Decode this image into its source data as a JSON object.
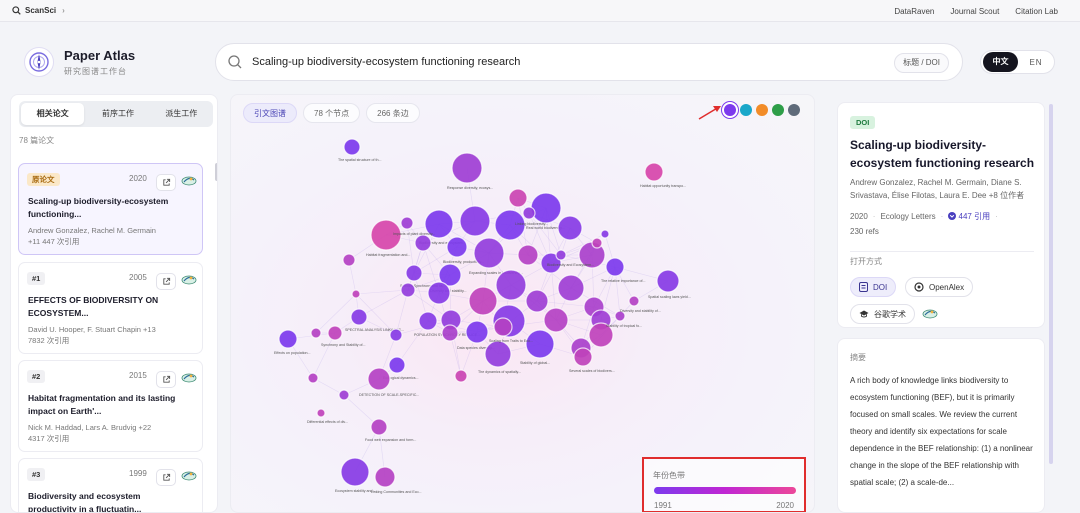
{
  "topbar": {
    "brand": "ScanSci",
    "links": [
      "DataRaven",
      "Journal Scout",
      "Citation Lab"
    ]
  },
  "header": {
    "app_title": "Paper Atlas",
    "app_subtitle": "研究图谱工作台",
    "search_value": "Scaling‐up biodiversity‐ecosystem functioning research",
    "search_tag": "标题 / DOI",
    "lang_active": "中文",
    "lang_other": "EN"
  },
  "left": {
    "tabs": [
      "相关论文",
      "前序工作",
      "派生工作"
    ],
    "count": "78 篇论文",
    "papers": [
      {
        "badge": "原论文",
        "year": "2020",
        "title": "Scaling‐up biodiversity‐ecosystem functioning...",
        "authors": "Andrew Gonzalez, Rachel M. Germain +11",
        "cites": "447 次引用"
      },
      {
        "badge": "#1",
        "year": "2005",
        "title": "EFFECTS OF BIODIVERSITY ON ECOSYSTEM...",
        "authors": "David U. Hooper, F. Stuart Chapin +13",
        "cites": "7832 次引用"
      },
      {
        "badge": "#2",
        "year": "2015",
        "title": "Habitat fragmentation and its lasting impact on Earth'...",
        "authors": "Nick M. Haddad, Lars A. Brudvig +22",
        "cites": "4317 次引用"
      },
      {
        "badge": "#3",
        "year": "1999",
        "title": "Biodiversity and ecosystem productivity in a fluctuatin...",
        "authors": "",
        "cites": ""
      }
    ]
  },
  "graph": {
    "tabs": [
      "引文图谱",
      "78 个节点",
      "266 条边"
    ],
    "swatches": [
      "#7c3aed",
      "#1aa7c9",
      "#f28c28",
      "#2e9e48",
      "#5f6b7a"
    ],
    "legend_title": "年份色带",
    "legend_start": "1991",
    "legend_end": "2020",
    "node_labels": [
      "The spatial structure of th...",
      "Response diversity, ecosys...",
      "Habitat opportunity transpo...",
      "Real world biodiversity...",
      "Biodiversity and ecosystem...",
      "Habitat fragmentation and...",
      "Biodiversity, productivity...",
      "Expanding scales in biodiversity...",
      "Species Synchrony and Its...",
      "Diversity and stability...",
      "The relative importance of...",
      "Spatial scaling laws yield...",
      "SPECTRAL ANALYSIS LINKAGES...",
      "POPULATION SYNCHRONY REDUCE...",
      "Effects on population...",
      "Synchrony and Stability of...",
      "Biodiversity and Ecosystem...",
      "Diversity and stability of...",
      "Data species diversity...",
      "Linking biodiversity...",
      "Stability of global...",
      "The dynamics of spatially...",
      "Impacts of plant diversity...",
      "Several scales of biodivers...",
      "Stability of tropical fo...",
      "DETECTION OF SCALE-SPECIFIC...",
      "Ecological dynamics...",
      "Scaling from Traits to Eco...",
      "Differential effects of div...",
      "Food web expansion and form...",
      "Ecosystem stability and...",
      "Linking Communities and Eco..."
    ]
  },
  "right": {
    "badge": "DOI",
    "title": "Scaling‐up biodiversity‐ecosystem functioning research",
    "authors": "Andrew Gonzalez, Rachel M. Germain, Diane S. Srivastava, Élise Filotas, Laura E. Dee +8 位作者",
    "year": "2020",
    "journal": "Ecology Letters",
    "cites": "447 引用",
    "refs": "230 refs",
    "open_label": "打开方式",
    "btn_doi": "DOI",
    "btn_openalex": "OpenAlex",
    "btn_scholar": "谷歌学术",
    "abstract_label": "摘要",
    "abstract_text": "A rich body of knowledge links biodiversity to ecosystem functioning (BEF), but it is primarily focused on small scales. We review the current theory and identify six expectations for scale dependence in the BEF relationship: (1) a nonlinear change in the slope of the BEF relationship with spatial scale; (2) a scale-de..."
  }
}
